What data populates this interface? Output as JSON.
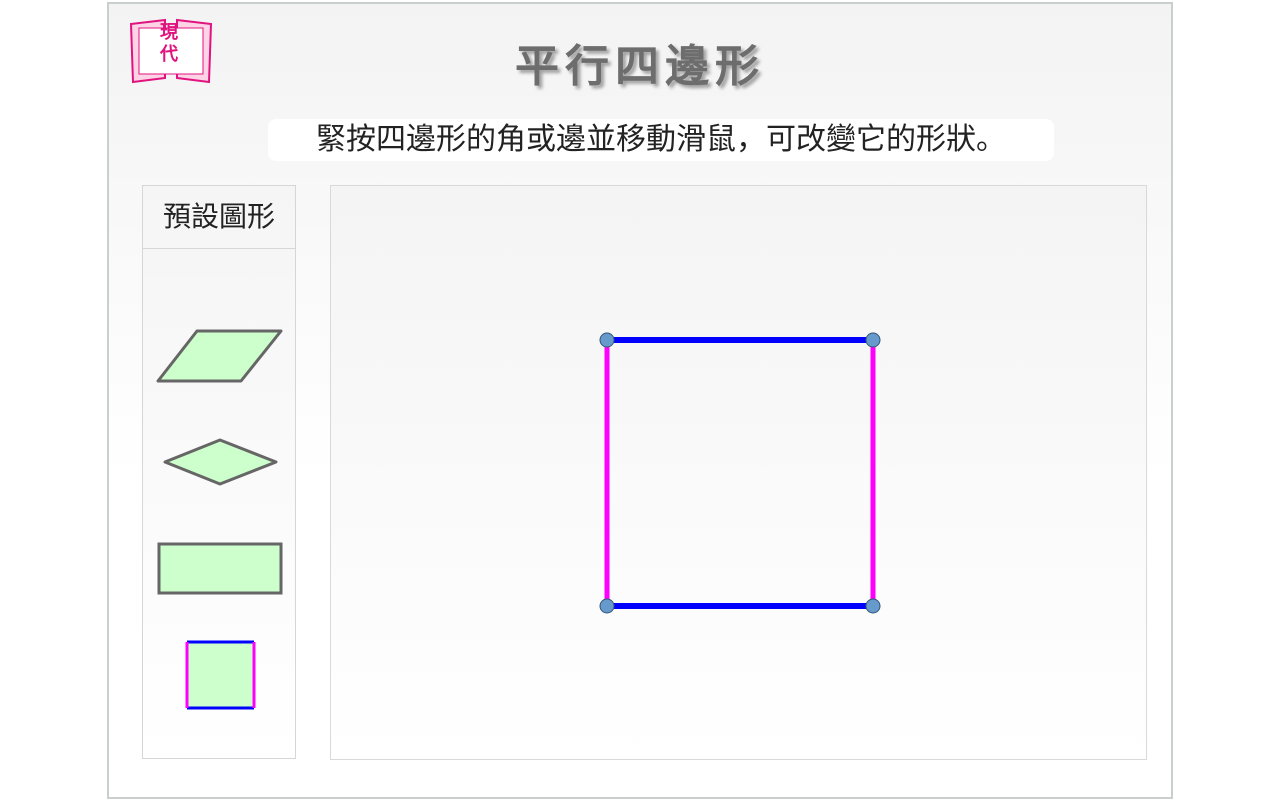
{
  "logo": {
    "text": "現代"
  },
  "title": "平行四邊形",
  "instruction": "緊按四邊形的角或邊並移動滑鼠，可改變它的形狀。",
  "presets": {
    "header": "預設圖形",
    "items": [
      {
        "name": "parallelogram",
        "fill": "#ccffcc",
        "stroke": "#666666"
      },
      {
        "name": "rhombus",
        "fill": "#ccffcc",
        "stroke": "#666666"
      },
      {
        "name": "rectangle",
        "fill": "#ccffcc",
        "stroke": "#666666"
      },
      {
        "name": "square",
        "fill": "#ccffcc",
        "side_colors": [
          "#0000ff",
          "#ff00ff"
        ]
      }
    ]
  },
  "colors": {
    "horizontal_sides": "#0000ff",
    "vertical_sides": "#ff00ff",
    "vertex_handles": "#6699cc",
    "logo_accent": "#e0137f"
  }
}
